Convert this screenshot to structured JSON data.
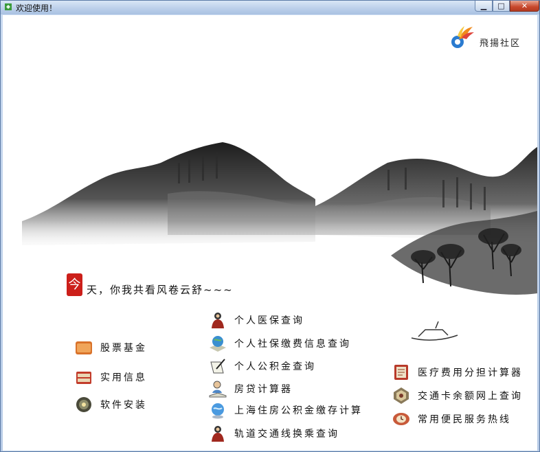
{
  "window": {
    "title": "欢迎使用！",
    "close_label": "✕",
    "maximize_label": "□",
    "minimize_label": "▁"
  },
  "logo": {
    "text": "飛揚社区"
  },
  "greeting": {
    "badge": "今",
    "text": "天，你我共看风卷云舒~~~"
  },
  "left_menu": [
    {
      "label": "股票基金",
      "icon": "folder-icon"
    },
    {
      "label": "实用信息",
      "icon": "ledger-icon"
    },
    {
      "label": "软件安装",
      "icon": "disc-icon"
    }
  ],
  "center_menu": [
    {
      "label": "个人医保查询",
      "icon": "figure-icon"
    },
    {
      "label": "个人社保缴费信息查询",
      "icon": "globe-book-icon"
    },
    {
      "label": "个人公积金查询",
      "icon": "pen-paper-icon"
    },
    {
      "label": "房贷计算器",
      "icon": "person-book-icon"
    },
    {
      "label": "上海住房公积金缴存计算",
      "icon": "globe-icon"
    },
    {
      "label": "轨道交通线换乘查询",
      "icon": "figure-icon"
    }
  ],
  "right_menu": [
    {
      "label": "医疗费用分担计算器",
      "icon": "notebook-icon"
    },
    {
      "label": "交通卡余额网上查询",
      "icon": "medal-icon"
    },
    {
      "label": "常用便民服务热线",
      "icon": "clock-icon"
    }
  ]
}
